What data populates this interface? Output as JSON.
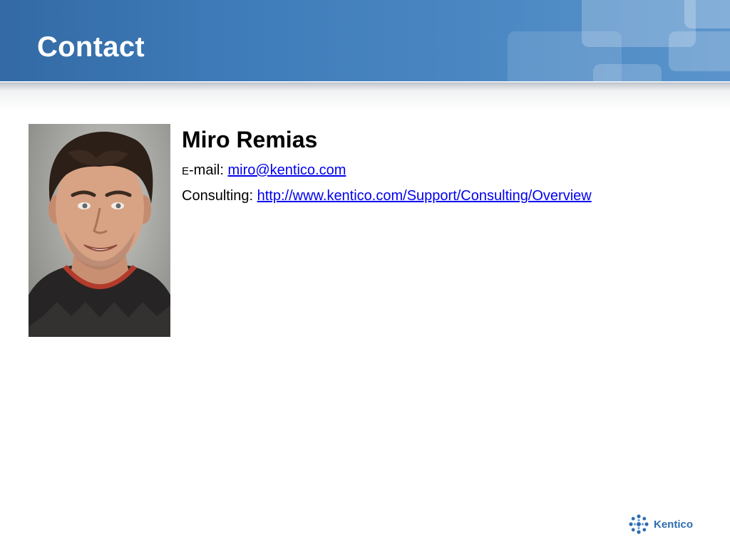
{
  "slide": {
    "title": "Contact"
  },
  "contact": {
    "name": "Miro Remias",
    "email": {
      "label_prefix": "E",
      "label_rest": "-mail:",
      "value": "miro@kentico.com"
    },
    "consulting": {
      "label": "Consulting:",
      "value": "http://www.kentico.com/Support/Consulting/Overview"
    }
  },
  "footer": {
    "logo_text": "Kentico"
  },
  "colors": {
    "header_blue": "#3f7dba",
    "link": "#0000ee",
    "logo_blue": "#2f6db0"
  }
}
